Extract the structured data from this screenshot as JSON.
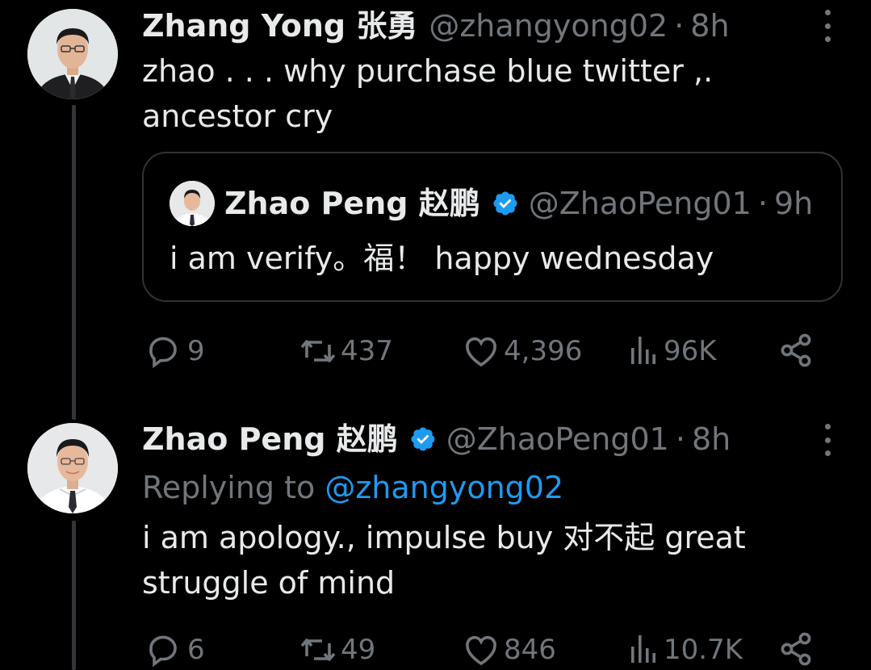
{
  "colors": {
    "background": "#000000",
    "text_primary": "#e7e9ea",
    "text_secondary": "#71767b",
    "link": "#1d9bf0",
    "verified_badge": "#1d9bf0",
    "border": "#2f3336"
  },
  "tweet1": {
    "display_name": "Zhang Yong 张勇",
    "handle": "@zhangyong02",
    "separator": "·",
    "time": "8h",
    "text": "zhao . . . why purchase blue twitter ,. ancestor cry",
    "quote": {
      "display_name": "Zhao Peng 赵鹏",
      "verified_icon": "verified-badge-icon",
      "handle": "@ZhaoPeng01",
      "separator": "·",
      "time": "9h",
      "text": "i am verify。福！ happy wednesday"
    },
    "actions": {
      "replies": "9",
      "retweets": "437",
      "likes": "4,396",
      "views": "96K"
    }
  },
  "tweet2": {
    "display_name": "Zhao Peng 赵鹏",
    "verified_icon": "verified-badge-icon",
    "handle": "@ZhaoPeng01",
    "separator": "·",
    "time": "8h",
    "replying_prefix": "Replying to",
    "replying_handle": "@zhangyong02",
    "text": "i am apology., impulse buy 对不起 great struggle of mind",
    "actions": {
      "replies": "6",
      "retweets": "49",
      "likes": "846",
      "views": "10.7K"
    }
  },
  "icons": {
    "reply": "reply-icon",
    "retweet": "retweet-icon",
    "like": "heart-icon",
    "views": "views-chart-icon",
    "share": "share-icon",
    "more": "more-icon"
  }
}
